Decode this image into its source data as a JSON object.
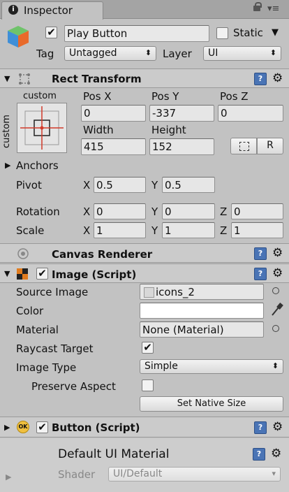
{
  "tab": {
    "title": "Inspector"
  },
  "object": {
    "name": "Play Button",
    "active": true,
    "static_label": "Static",
    "static_checked": false,
    "tag_label": "Tag",
    "tag_value": "Untagged",
    "layer_label": "Layer",
    "layer_value": "UI"
  },
  "rect_transform": {
    "title": "Rect Transform",
    "anchor_preset_top": "custom",
    "anchor_preset_side": "custom",
    "pos_x_label": "Pos X",
    "pos_x": "0",
    "pos_y_label": "Pos Y",
    "pos_y": "-337",
    "pos_z_label": "Pos Z",
    "pos_z": "0",
    "width_label": "Width",
    "width": "415",
    "height_label": "Height",
    "height": "152",
    "reset_button": "R",
    "anchors_label": "Anchors",
    "pivot_label": "Pivot",
    "pivot_x": "0.5",
    "pivot_y": "0.5",
    "rotation_label": "Rotation",
    "rotation_x": "0",
    "rotation_y": "0",
    "rotation_z": "0",
    "scale_label": "Scale",
    "scale_x": "1",
    "scale_y": "1",
    "scale_z": "1",
    "axis_x": "X",
    "axis_y": "Y",
    "axis_z": "Z"
  },
  "canvas_renderer": {
    "title": "Canvas Renderer"
  },
  "image": {
    "title": "Image (Script)",
    "enabled": true,
    "source_image_label": "Source Image",
    "source_image": "icons_2",
    "color_label": "Color",
    "color_value": "#ffffff",
    "material_label": "Material",
    "material": "None (Material)",
    "raycast_label": "Raycast Target",
    "raycast_checked": true,
    "image_type_label": "Image Type",
    "image_type": "Simple",
    "preserve_label": "Preserve Aspect",
    "preserve_checked": false,
    "native_size_button": "Set Native Size"
  },
  "button": {
    "title": "Button (Script)",
    "enabled": true,
    "icon_text": "OK"
  },
  "material_section": {
    "title": "Default UI Material",
    "shader_label": "Shader",
    "shader_value": "UI/Default"
  },
  "icons": {
    "info": "info-icon",
    "lock": "lock-icon",
    "menu": "tab-menu-icon",
    "cube": "gameobject-cube-icon",
    "help": "help-book-icon",
    "gear": "gear-icon",
    "eyedropper": "eyedropper-icon",
    "target": "object-picker-icon"
  }
}
